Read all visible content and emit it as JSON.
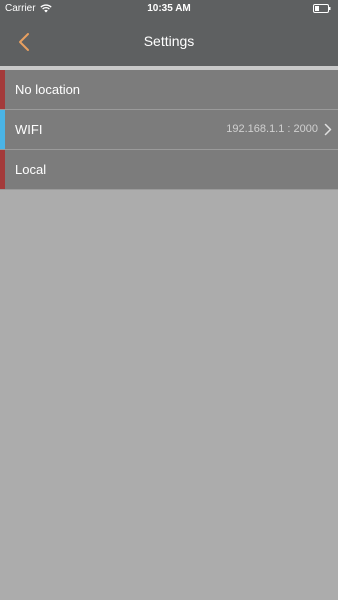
{
  "status_bar": {
    "carrier": "Carrier",
    "time": "10:35 AM",
    "wifi_icon": "wifi-icon",
    "battery_icon": "battery-icon"
  },
  "nav": {
    "title": "Settings",
    "back_icon": "chevron-left-icon",
    "back_color": "#e8a060"
  },
  "settings": {
    "items": [
      {
        "label": "No location",
        "detail": "",
        "accent": "#a33a3a"
      },
      {
        "label": "WIFI",
        "detail": "192.168.1.1 : 2000",
        "accent": "#4ab4e6",
        "chevron": "chevron-right-icon"
      },
      {
        "label": "Local",
        "detail": "",
        "accent": "#a33a3a"
      }
    ]
  }
}
